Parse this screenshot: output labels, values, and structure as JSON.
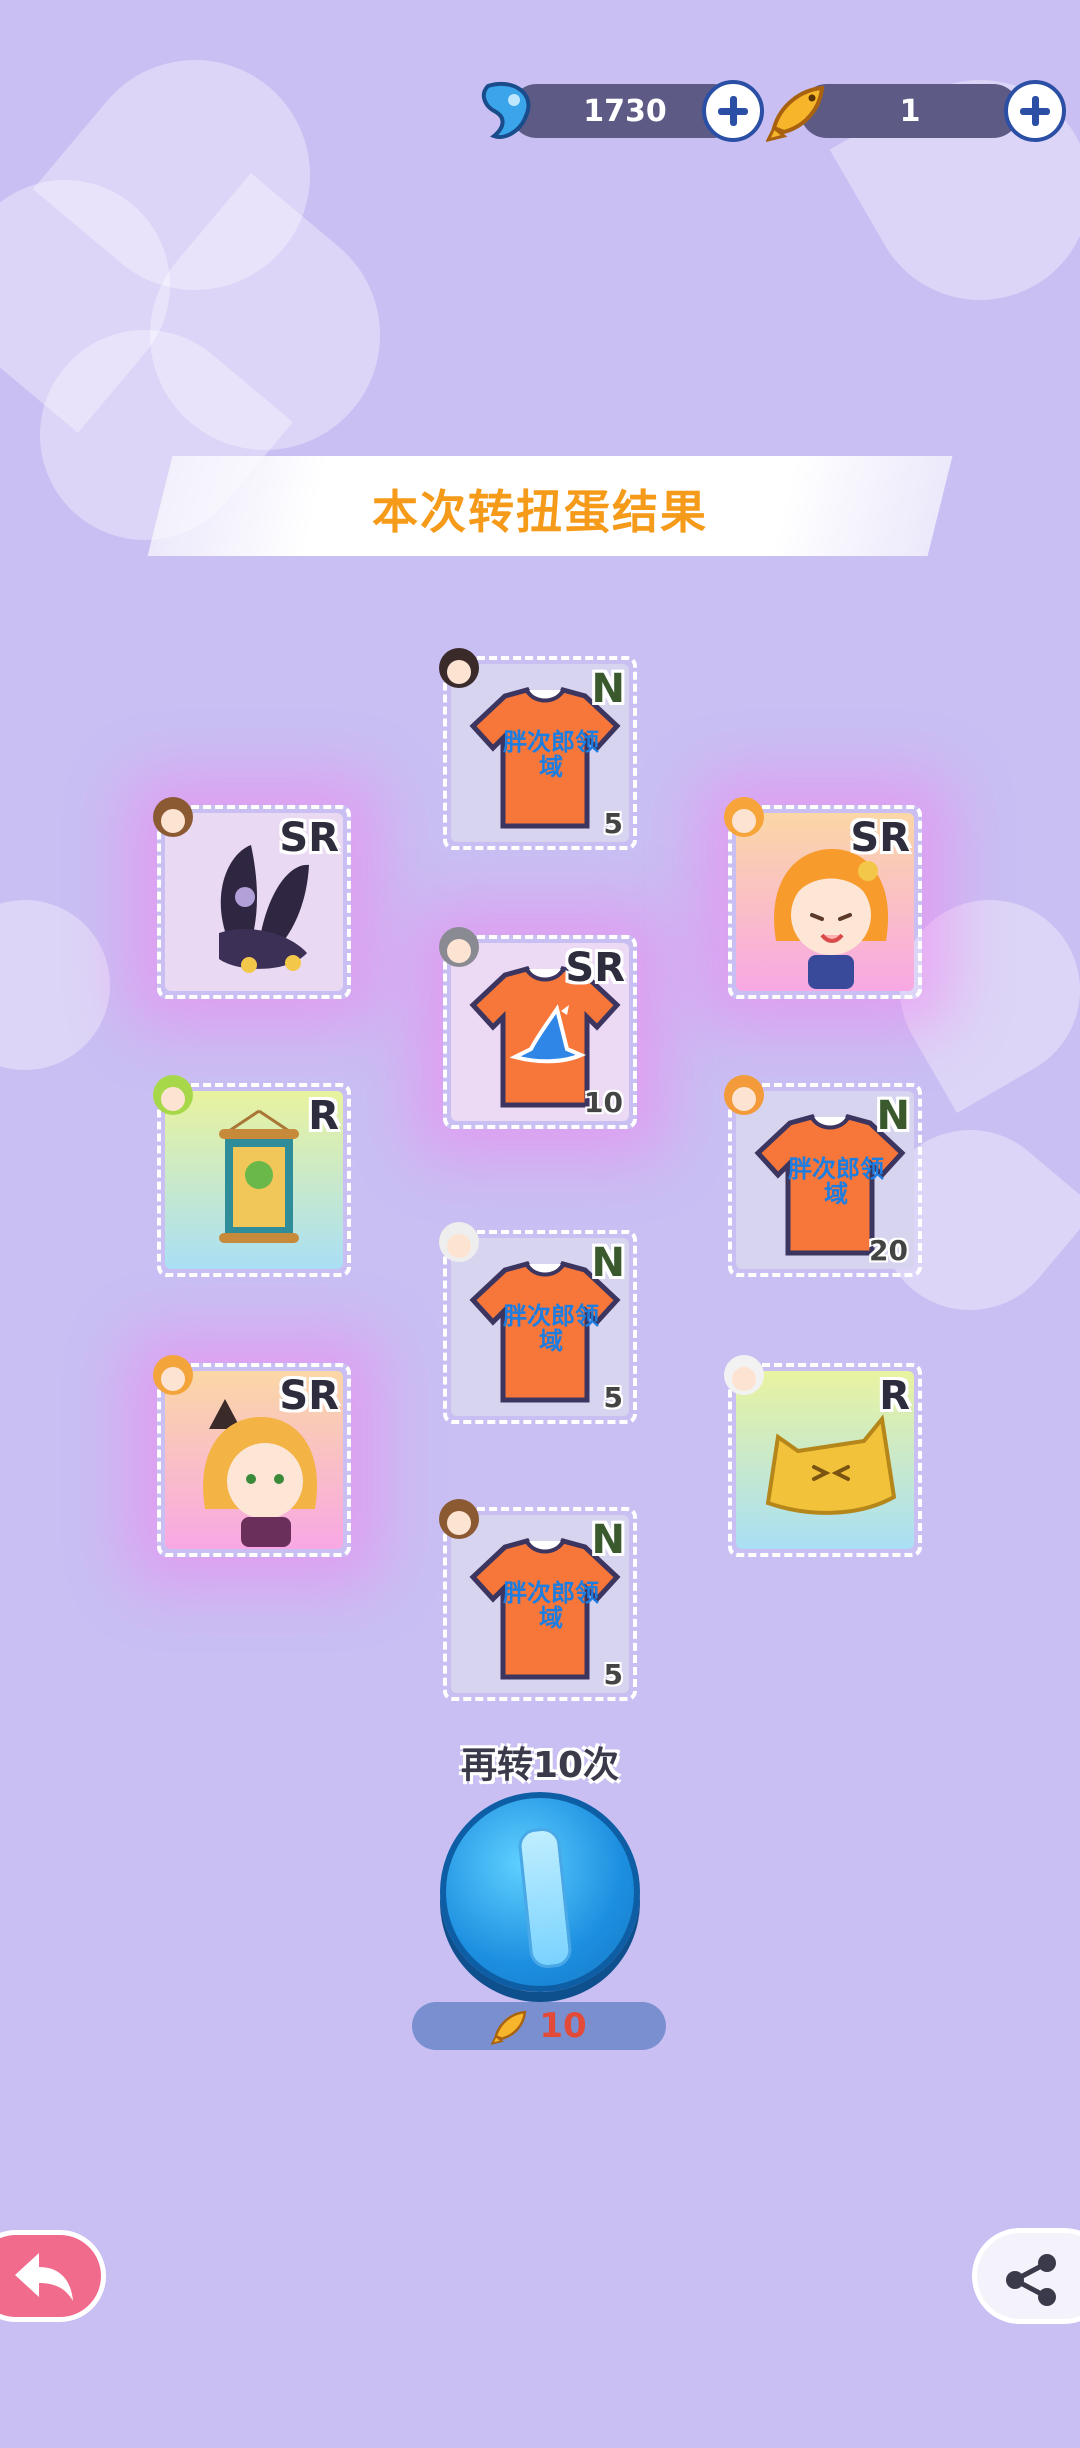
{
  "header": {
    "gems": {
      "value": "1730",
      "icon": "blue-gem-icon"
    },
    "fish": {
      "value": "1",
      "icon": "golden-fish-icon"
    }
  },
  "banner": {
    "title": "本次转扭蛋结果"
  },
  "results": [
    {
      "id": "c1",
      "rarity": "N",
      "type": "shirt",
      "qty": "5",
      "item": "orange-shirt-icon"
    },
    {
      "id": "c2",
      "rarity": "SR",
      "type": "bunny-ears",
      "qty": "",
      "item": "black-bunny-ears-icon"
    },
    {
      "id": "c3",
      "rarity": "SR",
      "type": "character",
      "qty": "",
      "item": "orange-hair-girl-icon"
    },
    {
      "id": "c4",
      "rarity": "SR",
      "type": "shirt",
      "qty": "10",
      "item": "witch-hat-shirt-icon"
    },
    {
      "id": "c5",
      "rarity": "R",
      "type": "scroll",
      "qty": "",
      "item": "hanging-scroll-icon"
    },
    {
      "id": "c6",
      "rarity": "N",
      "type": "shirt",
      "qty": "20",
      "item": "orange-shirt-icon"
    },
    {
      "id": "c7",
      "rarity": "N",
      "type": "shirt",
      "qty": "5",
      "item": "orange-shirt-icon"
    },
    {
      "id": "c8",
      "rarity": "SR",
      "type": "character",
      "qty": "",
      "item": "cat-ear-girl-icon"
    },
    {
      "id": "c9",
      "rarity": "R",
      "type": "cushion",
      "qty": "",
      "item": "yellow-cat-cushion-icon"
    },
    {
      "id": "c10",
      "rarity": "N",
      "type": "shirt",
      "qty": "5",
      "item": "orange-shirt-icon"
    }
  ],
  "shirt_text": "胖次郎领域",
  "spin": {
    "label": "再转10次",
    "cost": "10"
  },
  "colors": {
    "background": "#c9bff3",
    "accent": "#f59a19",
    "sr_glow": "#f878f0",
    "n_card": "#d7d4ef",
    "sr_card": "#f7b9e8",
    "r_card": "#e3f3a8"
  }
}
